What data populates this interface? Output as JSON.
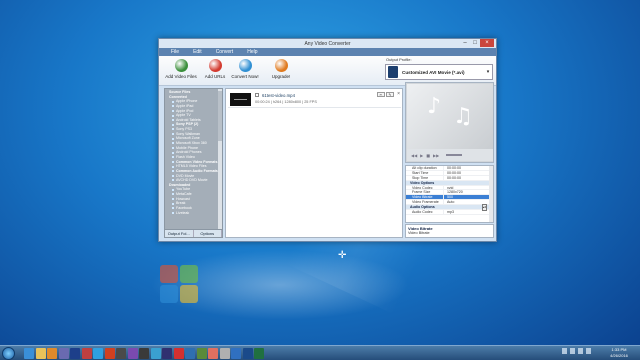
{
  "app": {
    "title": "Any Video Converter",
    "menu": [
      "File",
      "Edit",
      "Convert",
      "Help"
    ],
    "toolbar": [
      {
        "label": "Add Video Files",
        "icon": "add-video-icon",
        "color": "#3b8f3b"
      },
      {
        "label": "Add URLs",
        "icon": "add-url-icon",
        "color": "#d33a2f"
      },
      {
        "label": "Convert Now!",
        "icon": "convert-icon",
        "color": "#2f8fd3"
      },
      {
        "label": "Upgrade!",
        "icon": "upgrade-icon",
        "color": "#e07a1f"
      }
    ],
    "output_profile_label": "Output Profile:",
    "output_profile_value": "Customized AVI Movie (*.avi)"
  },
  "sidebar": {
    "tree": [
      {
        "text": "Source Files",
        "type": "grp"
      },
      {
        "text": "Converted",
        "type": "grp"
      },
      {
        "text": "Apple iPhone",
        "type": "item"
      },
      {
        "text": "Apple iPad",
        "type": "item"
      },
      {
        "text": "Apple iPod",
        "type": "item"
      },
      {
        "text": "Apple TV",
        "type": "item"
      },
      {
        "text": "Android Tablets",
        "type": "item"
      },
      {
        "text": "Sony PSP (2)",
        "type": "item",
        "bold": true
      },
      {
        "text": "Sony PS3",
        "type": "item"
      },
      {
        "text": "Sony Walkman",
        "type": "item"
      },
      {
        "text": "Microsoft Zune",
        "type": "item"
      },
      {
        "text": "Microsoft Xbox 360",
        "type": "item"
      },
      {
        "text": "Mobile Phone",
        "type": "item"
      },
      {
        "text": "Android Phones",
        "type": "item"
      },
      {
        "text": "Flash Video",
        "type": "item"
      },
      {
        "text": "Common Video Formats",
        "type": "item",
        "bold": true
      },
      {
        "text": "HTML5 Video Files",
        "type": "item"
      },
      {
        "text": "Common Audio Formats",
        "type": "item",
        "bold": true
      },
      {
        "text": "DVD Movie",
        "type": "item"
      },
      {
        "text": "AVCHD DVD Movie",
        "type": "item"
      },
      {
        "text": "Downloaded",
        "type": "grp"
      },
      {
        "text": "YouTube",
        "type": "item"
      },
      {
        "text": "MetaCafe",
        "type": "item"
      },
      {
        "text": "Howcast",
        "type": "item"
      },
      {
        "text": "Break",
        "type": "item"
      },
      {
        "text": "Facebook",
        "type": "item"
      },
      {
        "text": "Liveleak",
        "type": "item"
      }
    ],
    "tabs": [
      "Output Fol...",
      "Options"
    ]
  },
  "file": {
    "name": "61test-video.mp4",
    "info": "00:00:24  |  h264  |  1280x800  |  25 FPS"
  },
  "preview": {
    "controls": [
      "◀◀",
      "▶",
      "■",
      "▶▶"
    ]
  },
  "properties": [
    {
      "k": "Alt clip duration",
      "v": "00:00:00"
    },
    {
      "k": "Start Time",
      "v": "00:00:00"
    },
    {
      "k": "Stop Time",
      "v": "00:00:00"
    },
    {
      "header": "Video Options"
    },
    {
      "k": "Video Codec",
      "v": "xvid"
    },
    {
      "k": "Frame Size",
      "v": "1280x720"
    },
    {
      "k": "Video Bitrate",
      "v": "500",
      "sel": true
    },
    {
      "k": "Video Framerate",
      "v": "Auto"
    },
    {
      "header": "Audio Options"
    },
    {
      "k": "Audio Codec",
      "v": "mp3"
    }
  ],
  "property_desc": {
    "title": "Video Bitrate",
    "text": "Video Bitrate"
  },
  "taskbar": {
    "apps": [
      {
        "icon": "ie-icon",
        "color": "#3a8fd8"
      },
      {
        "icon": "folder-icon",
        "color": "#e8c25a"
      },
      {
        "icon": "media-player-icon",
        "color": "#e08a2a"
      },
      {
        "icon": "app-icon",
        "color": "#6a6ab0"
      },
      {
        "icon": "photoshop-icon",
        "color": "#1d3f8a"
      },
      {
        "icon": "app-icon",
        "color": "#c04040"
      },
      {
        "icon": "skype-icon",
        "color": "#2fa0e0"
      },
      {
        "icon": "app-icon",
        "color": "#d04020"
      },
      {
        "icon": "app-icon",
        "color": "#4a4a4a"
      },
      {
        "icon": "app-icon",
        "color": "#7a4ab0"
      },
      {
        "icon": "app-icon",
        "color": "#3a3a3a"
      },
      {
        "icon": "app-icon",
        "color": "#3aa0d0"
      },
      {
        "icon": "app-icon",
        "color": "#303070"
      },
      {
        "icon": "app-icon",
        "color": "#d43030"
      },
      {
        "icon": "app-icon",
        "color": "#2f6fb0"
      },
      {
        "icon": "app-icon",
        "color": "#5a8a3a"
      },
      {
        "icon": "app-icon",
        "color": "#e07060"
      },
      {
        "icon": "app-icon",
        "color": "#b0b0b0"
      },
      {
        "icon": "app-icon",
        "color": "#3070c0"
      },
      {
        "icon": "app-icon",
        "color": "#1a4a8a"
      },
      {
        "icon": "app-icon",
        "color": "#207040"
      }
    ],
    "time": "1:33 PM",
    "date": "4/26/2016"
  }
}
